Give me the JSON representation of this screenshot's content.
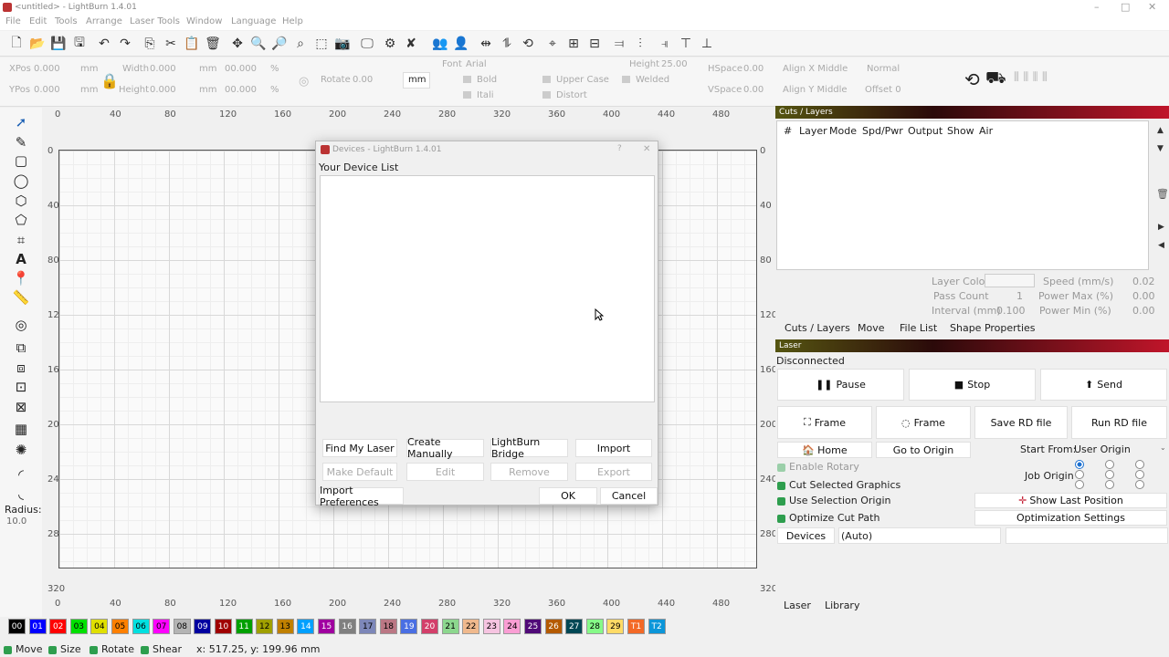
{
  "window": {
    "title": "<untitled> - LightBurn 1.4.01",
    "minimize": "–",
    "maximize": "□",
    "close": "✕"
  },
  "menu": [
    "File",
    "Edit",
    "Tools",
    "Arrange",
    "Laser Tools",
    "Window",
    "Language",
    "Help"
  ],
  "props": {
    "xpos_label": "XPos",
    "xpos": "0.000",
    "ypos_label": "YPos",
    "ypos": "0.000",
    "unit": "mm",
    "width_label": "Width",
    "width": "0.000",
    "height_label": "Height",
    "height": "0.000",
    "wpct": "00.000",
    "hpct": "00.000",
    "pct": "%",
    "rotate_label": "Rotate",
    "rotate": "0.00",
    "rot_unit": "mm",
    "font_label": "Font",
    "font": "Arial",
    "text_height_label": "Height",
    "text_height": "25.00",
    "bold": "Bold",
    "italic": "Itali",
    "upper": "Upper Case",
    "distort": "Distort",
    "welded": "Welded",
    "hspace_label": "HSpace",
    "hspace": "0.00",
    "vspace_label": "VSpace",
    "vspace": "0.00",
    "alignx": "Align X Middle",
    "aligny": "Align Y Middle",
    "mode": "Normal",
    "offset": "Offset 0"
  },
  "rulers": {
    "top": [
      "0",
      "40",
      "80",
      "120",
      "160",
      "200",
      "240",
      "280",
      "320",
      "360",
      "400",
      "440",
      "480"
    ],
    "left": [
      "0",
      "40",
      "80",
      "120",
      "160",
      "200",
      "240",
      "280",
      "320"
    ]
  },
  "radius": {
    "label": "Radius:",
    "value": "10.0"
  },
  "cuts": {
    "title": "Cuts / Layers",
    "columns": [
      "#",
      "Layer",
      "Mode",
      "Spd/Pwr",
      "Output",
      "Show",
      "Air"
    ],
    "layer_color": "Layer Color",
    "speed": "Speed (mm/s)",
    "speed_val": "0.02",
    "pass_count": "Pass Count",
    "pass_val": "1",
    "power_max": "Power Max (%)",
    "pmax_val": "0.00",
    "interval": "Interval (mm)",
    "interval_val": "0.100",
    "power_min": "Power Min (%)",
    "pmin_val": "0.00"
  },
  "tabs_top": [
    "Cuts / Layers",
    "Move",
    "File List",
    "Shape Properties"
  ],
  "laser": {
    "title": "Laser",
    "status": "Disconnected",
    "pause": "Pause",
    "stop": "Stop",
    "send": "Send",
    "frame1": "Frame",
    "frame2": "Frame",
    "save_rd": "Save RD file",
    "run_rd": "Run RD file",
    "home": "Home",
    "go_origin": "Go to Origin",
    "start_from_label": "Start From:",
    "start_from": "User Origin",
    "enable_rotary": "Enable Rotary",
    "job_origin": "Job Origin",
    "cut_selected": "Cut Selected Graphics",
    "use_selection": "Use Selection Origin",
    "optimize": "Optimize Cut Path",
    "show_last": "Show Last Position",
    "opt_settings": "Optimization Settings",
    "devices": "Devices",
    "device_sel": "(Auto)"
  },
  "tabs_bottom": [
    "Laser",
    "Library"
  ],
  "dialog": {
    "title": "Devices - LightBurn 1.4.01",
    "help": "?",
    "close": "✕",
    "list_label": "Your Device List",
    "find": "Find My Laser",
    "create": "Create Manually",
    "bridge": "LightBurn Bridge",
    "import": "Import",
    "make_default": "Make Default",
    "edit": "Edit",
    "remove": "Remove",
    "export": "Export",
    "import_prefs": "Import Preferences",
    "ok": "OK",
    "cancel": "Cancel"
  },
  "palette": [
    {
      "t": "00",
      "c": "#000000",
      "f": "#ffffff"
    },
    {
      "t": "01",
      "c": "#0000ff",
      "f": "#ffffff"
    },
    {
      "t": "02",
      "c": "#ff0000",
      "f": "#ffffff"
    },
    {
      "t": "03",
      "c": "#00e000",
      "f": "#000000"
    },
    {
      "t": "04",
      "c": "#e0e000",
      "f": "#000000"
    },
    {
      "t": "05",
      "c": "#ff8000",
      "f": "#000000"
    },
    {
      "t": "06",
      "c": "#00e0e0",
      "f": "#000000"
    },
    {
      "t": "07",
      "c": "#ff00ff",
      "f": "#000000"
    },
    {
      "t": "08",
      "c": "#b4b4b4",
      "f": "#000000"
    },
    {
      "t": "09",
      "c": "#0000a0",
      "f": "#ffffff"
    },
    {
      "t": "10",
      "c": "#a00000",
      "f": "#ffffff"
    },
    {
      "t": "11",
      "c": "#00a000",
      "f": "#ffffff"
    },
    {
      "t": "12",
      "c": "#a0a000",
      "f": "#000000"
    },
    {
      "t": "13",
      "c": "#c08000",
      "f": "#000000"
    },
    {
      "t": "14",
      "c": "#00a0ff",
      "f": "#ffffff"
    },
    {
      "t": "15",
      "c": "#a000a0",
      "f": "#ffffff"
    },
    {
      "t": "16",
      "c": "#808080",
      "f": "#ffffff"
    },
    {
      "t": "17",
      "c": "#7d87b9",
      "f": "#000000"
    },
    {
      "t": "18",
      "c": "#bb7784",
      "f": "#000000"
    },
    {
      "t": "19",
      "c": "#4a6fe3",
      "f": "#ffffff"
    },
    {
      "t": "20",
      "c": "#d33f6a",
      "f": "#ffffff"
    },
    {
      "t": "21",
      "c": "#8cd78e",
      "f": "#000000"
    },
    {
      "t": "22",
      "c": "#f0b98d",
      "f": "#000000"
    },
    {
      "t": "23",
      "c": "#f6c4e1",
      "f": "#000000"
    },
    {
      "t": "24",
      "c": "#fa9ed4",
      "f": "#000000"
    },
    {
      "t": "25",
      "c": "#500a78",
      "f": "#ffffff"
    },
    {
      "t": "26",
      "c": "#b45a00",
      "f": "#ffffff"
    },
    {
      "t": "27",
      "c": "#004754",
      "f": "#ffffff"
    },
    {
      "t": "28",
      "c": "#86fa88",
      "f": "#000000"
    },
    {
      "t": "29",
      "c": "#ffdb66",
      "f": "#000000"
    },
    {
      "t": "T1",
      "c": "#f36926",
      "f": "#ffffff"
    },
    {
      "t": "T2",
      "c": "#0c96d9",
      "f": "#ffffff"
    }
  ],
  "status": {
    "move": "Move",
    "size": "Size",
    "rotate": "Rotate",
    "shear": "Shear",
    "coords": "x: 517.25, y: 199.96 mm"
  }
}
